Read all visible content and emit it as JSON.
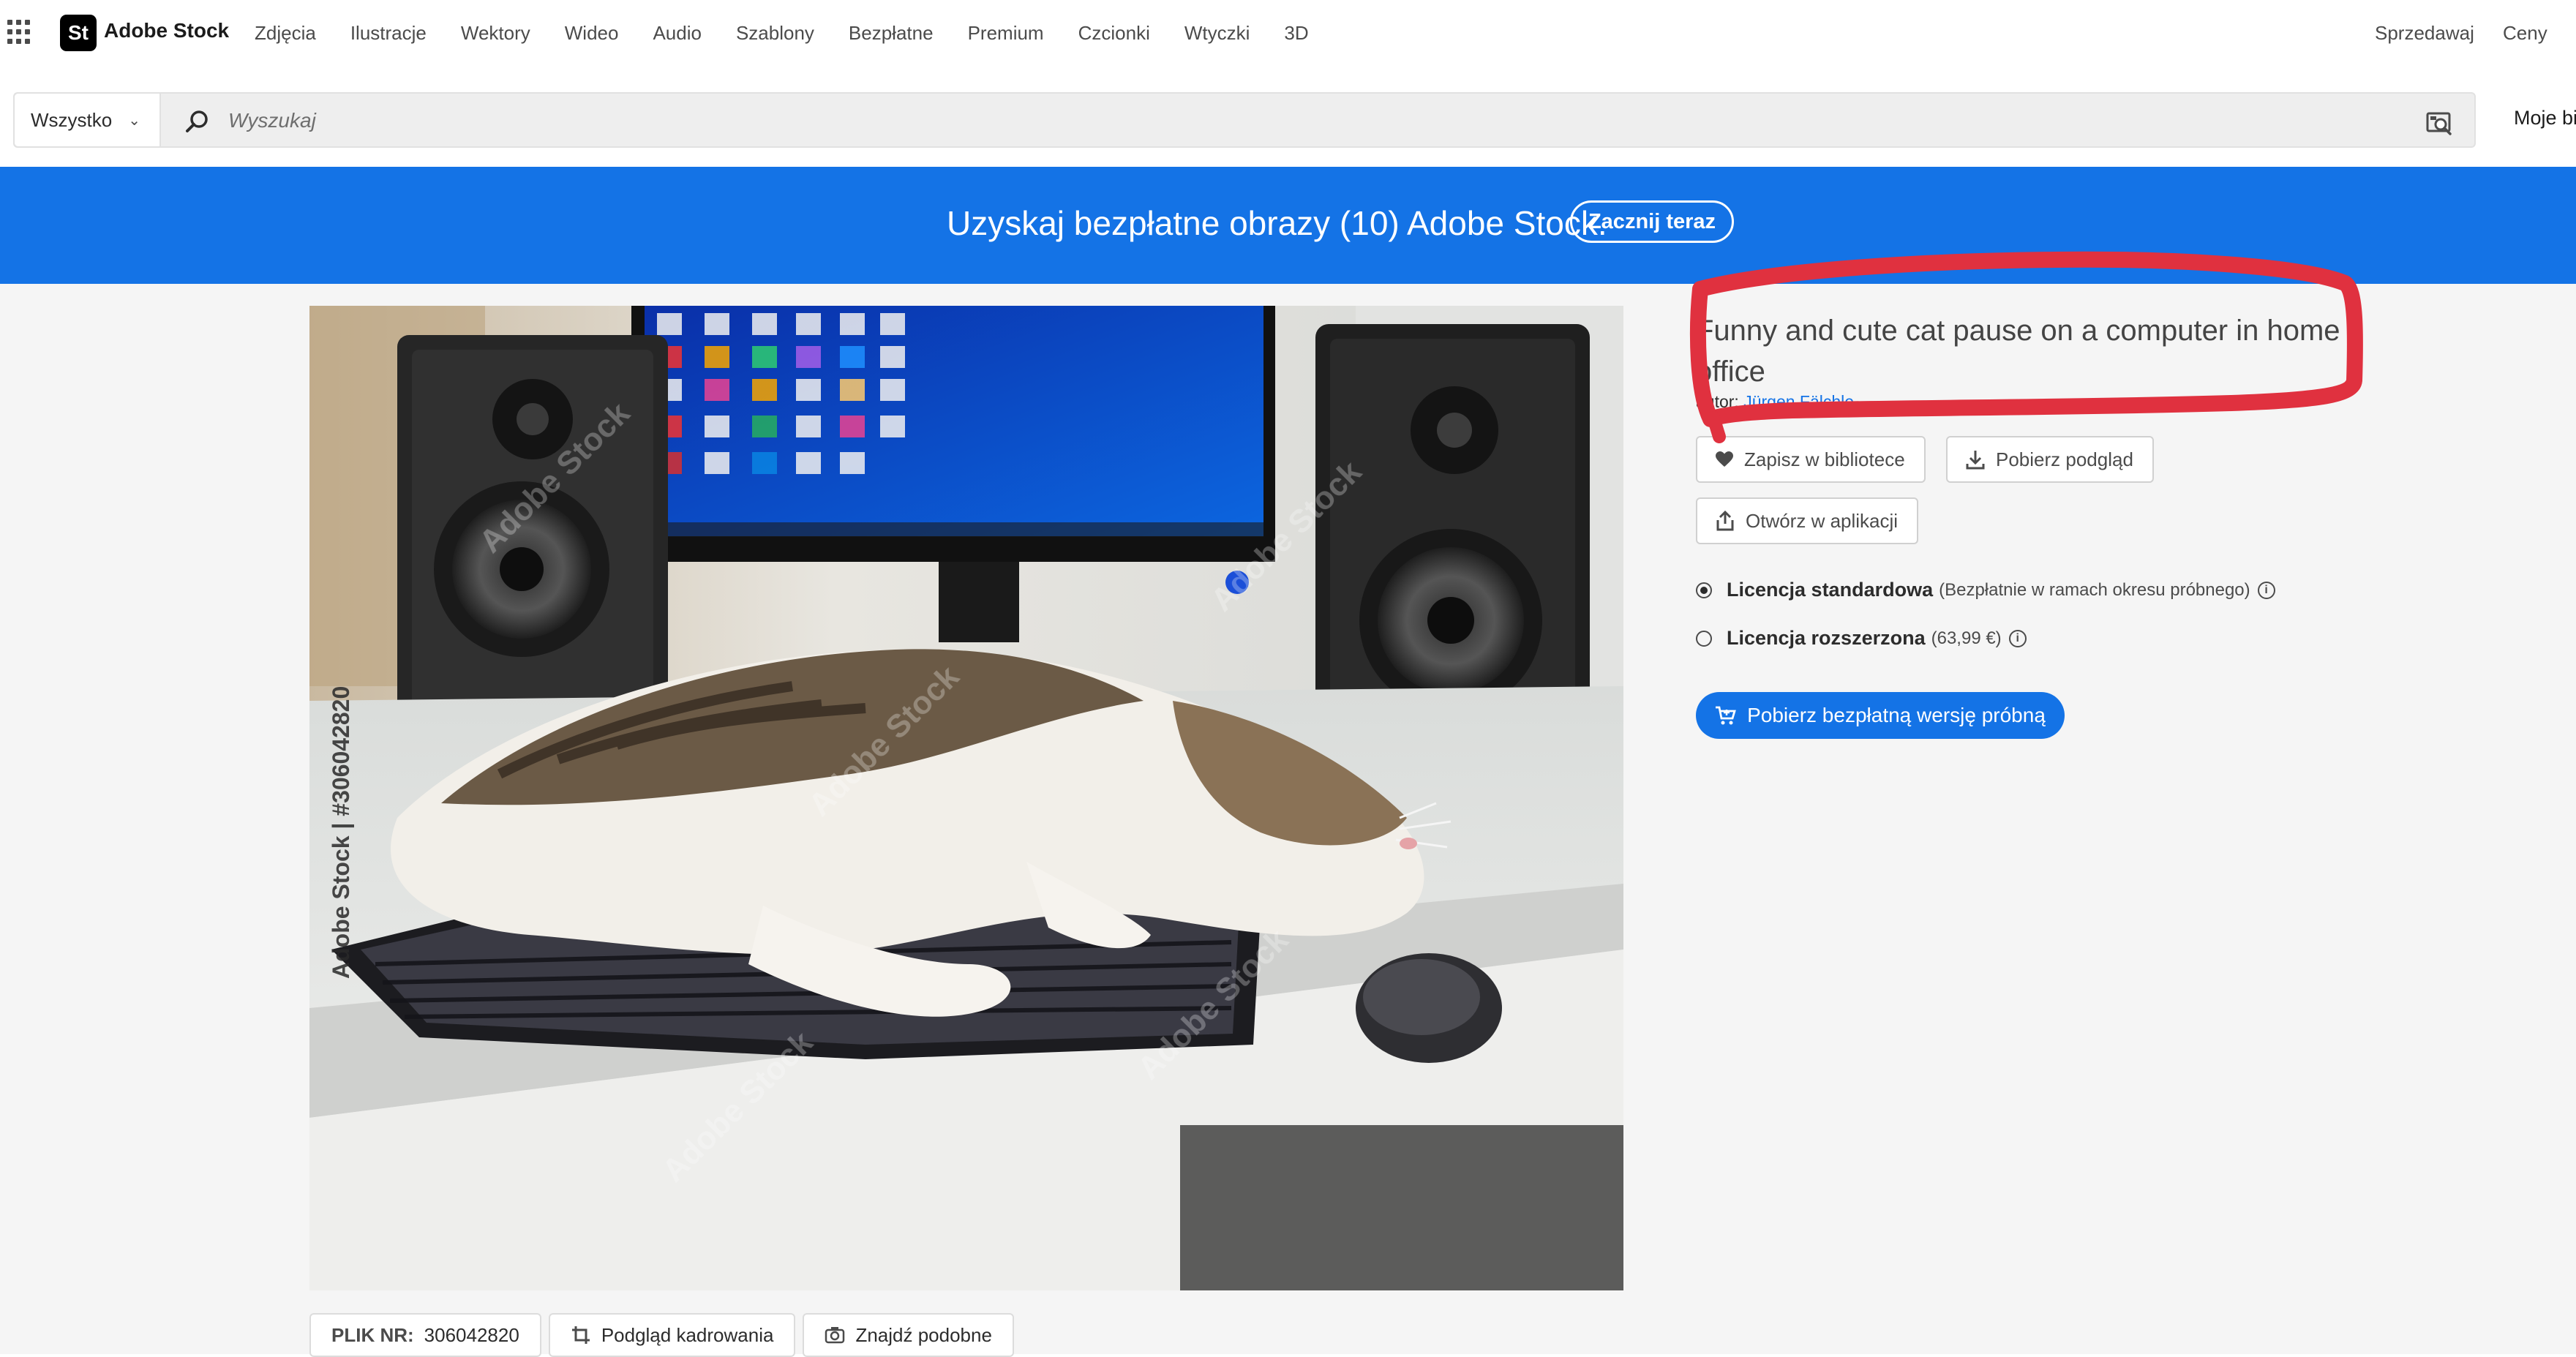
{
  "app": {
    "logo_tile": "St",
    "name": "Adobe Stock"
  },
  "nav": {
    "links": [
      "Zdjęcia",
      "Ilustracje",
      "Wektory",
      "Wideo",
      "Audio",
      "Szablony",
      "Bezpłatne",
      "Premium",
      "Czcionki",
      "Wtyczki",
      "3D"
    ],
    "right": [
      "Sprzedawaj",
      "Ceny"
    ]
  },
  "search": {
    "scope": "Wszystko",
    "placeholder": "Wyszukaj",
    "account_link": "Moje bi"
  },
  "banner": {
    "text": "Uzyskaj bezpłatne obrazy (10) Adobe Stock.",
    "button": "Zacznij teraz",
    "color": "#1473e6"
  },
  "asset": {
    "title": "Funny and cute cat pause on a computer in home office",
    "author_prefix": "autor:",
    "author": "Jürgen Fälchle",
    "watermark_id": "Adobe Stock | #306042820",
    "watermark_text": "Adobe Stock",
    "file_label": "PLIK NR:",
    "file_number": "306042820",
    "crop_preview": "Podgląd kadrowania",
    "find_similar": "Znajdź podobne"
  },
  "actions": {
    "save": "Zapisz w bibliotece",
    "download_preview": "Pobierz podgląd",
    "open_in_app": "Otwórz w aplikacji"
  },
  "licenses": [
    {
      "name": "Licencja standardowa",
      "detail": "(Bezpłatnie w ramach okresu próbnego)",
      "selected": true
    },
    {
      "name": "Licencja rozszerzona",
      "detail": "(63,99 €)",
      "selected": false
    }
  ],
  "cta": {
    "label": "Pobierz bezpłatną wersję próbną",
    "color": "#1473e6"
  },
  "annotation": {
    "color": "#e0313f"
  }
}
